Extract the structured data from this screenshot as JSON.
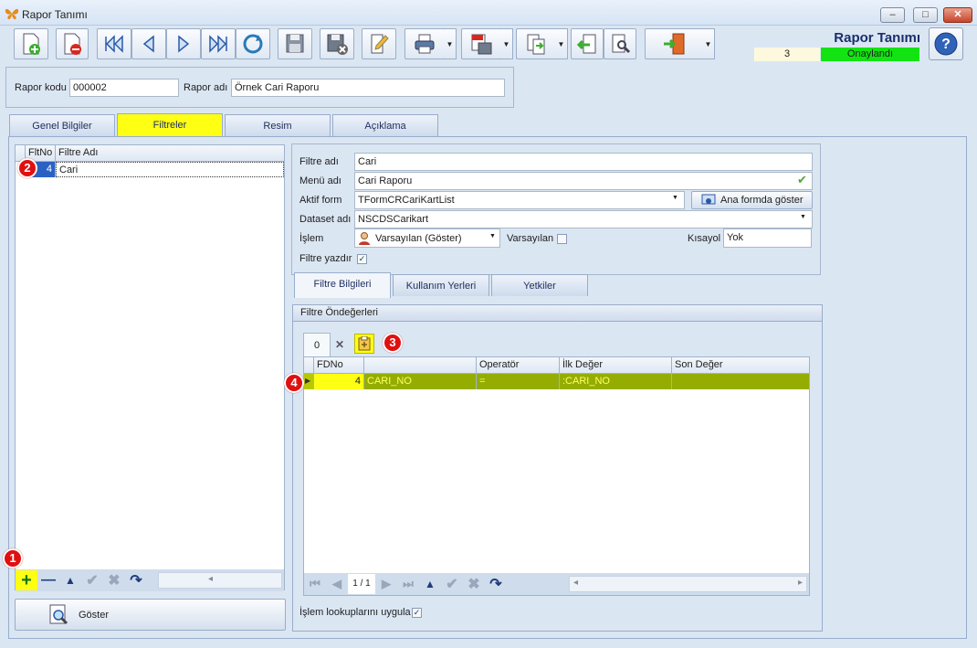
{
  "window": {
    "title": "Rapor Tanımı",
    "minimize": "–",
    "maximize": "□",
    "close": "✕"
  },
  "header": {
    "title": "Rapor Tanımı",
    "number": "3",
    "status": "Onaylandı",
    "status_color": "#13e313"
  },
  "toolbar": {
    "icons": [
      "new-document-icon",
      "delete-document-icon",
      "first-record-icon",
      "previous-record-icon",
      "next-record-icon",
      "last-record-icon",
      "refresh-icon",
      "save-icon",
      "save-close-icon",
      "edit-icon",
      "print-icon",
      "pdf-export-icon",
      "export-icon",
      "import-icon",
      "tools-icon",
      "exit-icon",
      "help-icon"
    ]
  },
  "code_section": {
    "code_label": "Rapor kodu",
    "code_value": "000002",
    "name_label": "Rapor adı",
    "name_value": "Örnek Cari Raporu"
  },
  "tabs": [
    {
      "label": "Genel Bilgiler"
    },
    {
      "label": "Filtreler"
    },
    {
      "label": "Resim"
    },
    {
      "label": "Açıklama"
    }
  ],
  "filter_list": {
    "columns": [
      "FltNo",
      "Filtre Adı"
    ],
    "rows": [
      {
        "no": "4",
        "name": "Cari"
      }
    ],
    "nav": {
      "add": "+",
      "remove": "—",
      "up": "▲",
      "confirm": "✔",
      "cancel": "✖",
      "redo": "↷"
    },
    "show_button": "Göster"
  },
  "filter_form": {
    "name_label": "Filtre adı",
    "name_value": "Cari",
    "menu_label": "Menü adı",
    "menu_value": "Cari Raporu",
    "form_label": "Aktif form",
    "form_value": "TFormCRCariKartList",
    "form_button": "Ana formda göster",
    "dataset_label": "Dataset adı",
    "dataset_value": "NSCDSCarikart",
    "action_label": "İşlem",
    "action_value": "Varsayılan (Göster)",
    "default_label": "Varsayılan",
    "shortcut_label": "Kısayol",
    "shortcut_value": "Yok",
    "print_label": "Filtre yazdır"
  },
  "sub_tabs": [
    {
      "label": "Filtre Bilgileri"
    },
    {
      "label": "Kullanım Yerleri"
    },
    {
      "label": "Yetkiler"
    }
  ],
  "defaults": {
    "group_title": "Filtre Öndeğerleri",
    "set_tab": "0",
    "set_close": "✕",
    "columns": [
      "FDNo",
      "",
      "Operatör",
      "İlk Değer",
      "Son Değer"
    ],
    "rows": [
      {
        "no": "4",
        "field": "CARI_NO",
        "op": "=",
        "first": ":CARI_NO",
        "last": ""
      }
    ],
    "page": "1 / 1",
    "lookup_label": "İşlem lookuplarını uygula"
  },
  "badges": [
    "1",
    "2",
    "3",
    "4"
  ]
}
